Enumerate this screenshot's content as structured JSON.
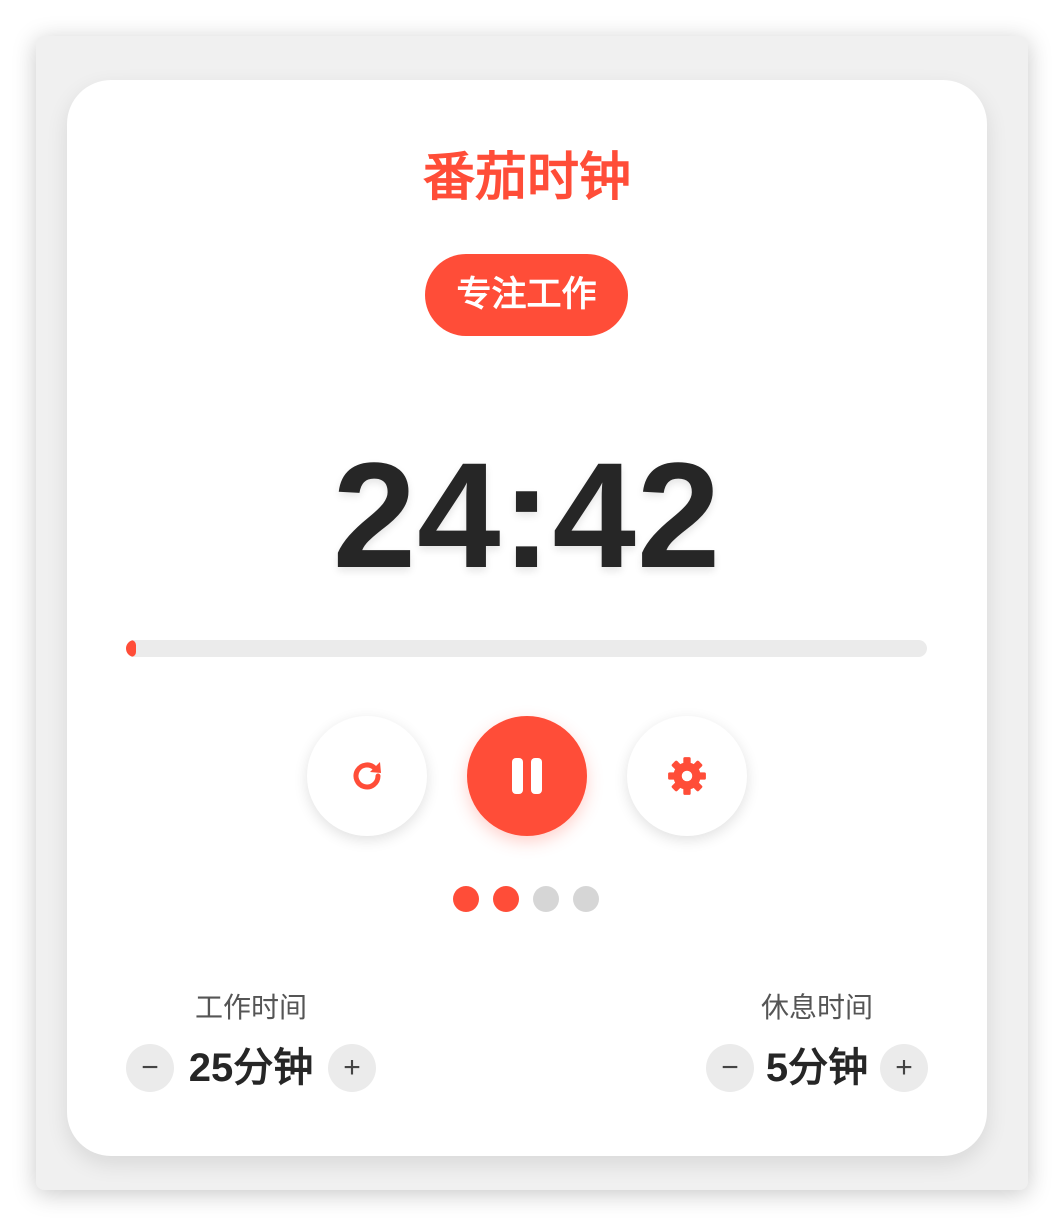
{
  "app": {
    "title": "番茄时钟"
  },
  "mode": {
    "label": "专注工作"
  },
  "timer": {
    "display": "24:42",
    "progress_fraction": 0.012
  },
  "controls": {
    "reset_icon": "reset-icon",
    "pause_icon": "pause-icon",
    "settings_icon": "gear-icon"
  },
  "sessions": {
    "completed": 2,
    "total": 4
  },
  "settings": {
    "work": {
      "label": "工作时间",
      "value": "25分钟",
      "decrement": "−",
      "increment": "+"
    },
    "rest": {
      "label": "休息时间",
      "value": "5分钟",
      "decrement": "−",
      "increment": "+"
    }
  },
  "colors": {
    "accent": "#ff4d38",
    "text_dark": "#262626",
    "track": "#ebebeb",
    "dot_inactive": "#d6d6d6"
  }
}
